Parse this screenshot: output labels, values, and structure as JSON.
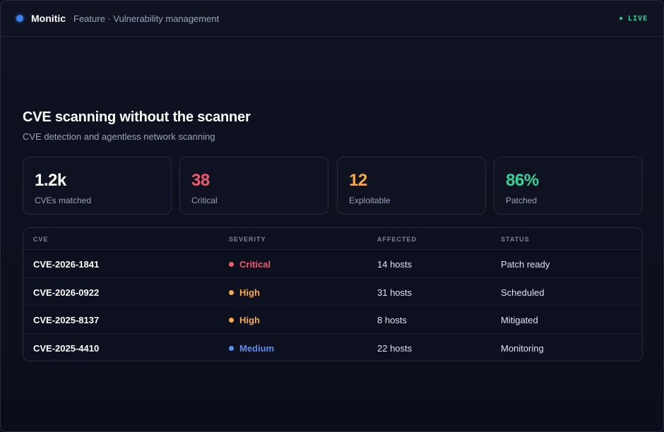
{
  "header": {
    "brand": "Monitic",
    "subtitle": "Feature · Vulnerability management",
    "live_label": "LIVE",
    "colors": {
      "brand_dot": "#3b82f6",
      "live": "#34d399"
    }
  },
  "hero": {
    "title": "CVE scanning without the scanner",
    "subtitle": "CVE detection and agentless network scanning"
  },
  "stats": [
    {
      "value": "1.2k",
      "label": "CVEs matched",
      "color": "#ffffff"
    },
    {
      "value": "38",
      "label": "Critical",
      "color": "#f05a6e"
    },
    {
      "value": "12",
      "label": "Exploitable",
      "color": "#f5a947"
    },
    {
      "value": "86%",
      "label": "Patched",
      "color": "#34d399"
    }
  ],
  "table": {
    "columns": [
      "CVE",
      "SEVERITY",
      "AFFECTED",
      "STATUS"
    ],
    "rows": [
      {
        "cve": "CVE-2026-1841",
        "severity": "Critical",
        "severity_color": "#f05a6e",
        "affected": "14 hosts",
        "status": "Patch ready"
      },
      {
        "cve": "CVE-2026-0922",
        "severity": "High",
        "severity_color": "#f5a947",
        "affected": "31 hosts",
        "status": "Scheduled"
      },
      {
        "cve": "CVE-2025-8137",
        "severity": "High",
        "severity_color": "#f5a947",
        "affected": "8 hosts",
        "status": "Mitigated"
      },
      {
        "cve": "CVE-2025-4410",
        "severity": "Medium",
        "severity_color": "#5b8def",
        "affected": "22 hosts",
        "status": "Monitoring"
      }
    ]
  }
}
